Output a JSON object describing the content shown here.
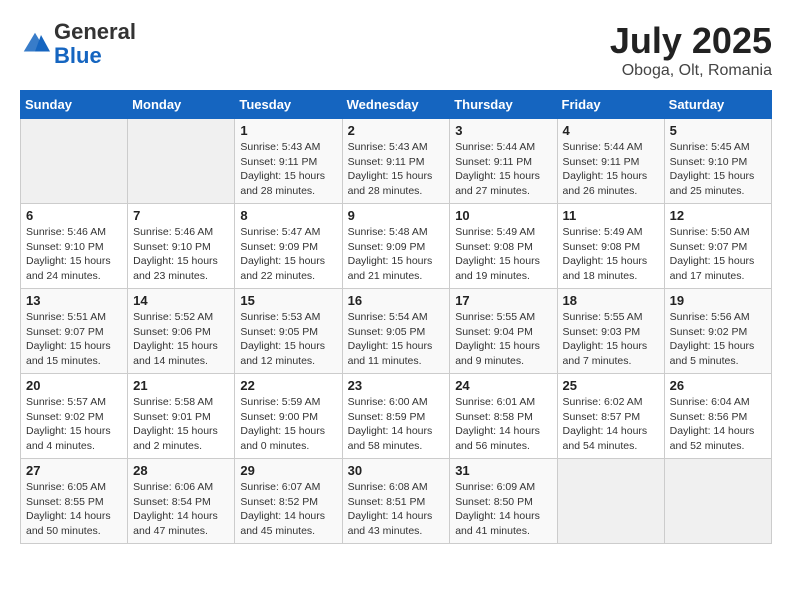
{
  "header": {
    "logo_general": "General",
    "logo_blue": "Blue",
    "month_title": "July 2025",
    "location": "Oboga, Olt, Romania"
  },
  "weekdays": [
    "Sunday",
    "Monday",
    "Tuesday",
    "Wednesday",
    "Thursday",
    "Friday",
    "Saturday"
  ],
  "weeks": [
    [
      {
        "day": "",
        "info": ""
      },
      {
        "day": "",
        "info": ""
      },
      {
        "day": "1",
        "info": "Sunrise: 5:43 AM\nSunset: 9:11 PM\nDaylight: 15 hours\nand 28 minutes."
      },
      {
        "day": "2",
        "info": "Sunrise: 5:43 AM\nSunset: 9:11 PM\nDaylight: 15 hours\nand 28 minutes."
      },
      {
        "day": "3",
        "info": "Sunrise: 5:44 AM\nSunset: 9:11 PM\nDaylight: 15 hours\nand 27 minutes."
      },
      {
        "day": "4",
        "info": "Sunrise: 5:44 AM\nSunset: 9:11 PM\nDaylight: 15 hours\nand 26 minutes."
      },
      {
        "day": "5",
        "info": "Sunrise: 5:45 AM\nSunset: 9:10 PM\nDaylight: 15 hours\nand 25 minutes."
      }
    ],
    [
      {
        "day": "6",
        "info": "Sunrise: 5:46 AM\nSunset: 9:10 PM\nDaylight: 15 hours\nand 24 minutes."
      },
      {
        "day": "7",
        "info": "Sunrise: 5:46 AM\nSunset: 9:10 PM\nDaylight: 15 hours\nand 23 minutes."
      },
      {
        "day": "8",
        "info": "Sunrise: 5:47 AM\nSunset: 9:09 PM\nDaylight: 15 hours\nand 22 minutes."
      },
      {
        "day": "9",
        "info": "Sunrise: 5:48 AM\nSunset: 9:09 PM\nDaylight: 15 hours\nand 21 minutes."
      },
      {
        "day": "10",
        "info": "Sunrise: 5:49 AM\nSunset: 9:08 PM\nDaylight: 15 hours\nand 19 minutes."
      },
      {
        "day": "11",
        "info": "Sunrise: 5:49 AM\nSunset: 9:08 PM\nDaylight: 15 hours\nand 18 minutes."
      },
      {
        "day": "12",
        "info": "Sunrise: 5:50 AM\nSunset: 9:07 PM\nDaylight: 15 hours\nand 17 minutes."
      }
    ],
    [
      {
        "day": "13",
        "info": "Sunrise: 5:51 AM\nSunset: 9:07 PM\nDaylight: 15 hours\nand 15 minutes."
      },
      {
        "day": "14",
        "info": "Sunrise: 5:52 AM\nSunset: 9:06 PM\nDaylight: 15 hours\nand 14 minutes."
      },
      {
        "day": "15",
        "info": "Sunrise: 5:53 AM\nSunset: 9:05 PM\nDaylight: 15 hours\nand 12 minutes."
      },
      {
        "day": "16",
        "info": "Sunrise: 5:54 AM\nSunset: 9:05 PM\nDaylight: 15 hours\nand 11 minutes."
      },
      {
        "day": "17",
        "info": "Sunrise: 5:55 AM\nSunset: 9:04 PM\nDaylight: 15 hours\nand 9 minutes."
      },
      {
        "day": "18",
        "info": "Sunrise: 5:55 AM\nSunset: 9:03 PM\nDaylight: 15 hours\nand 7 minutes."
      },
      {
        "day": "19",
        "info": "Sunrise: 5:56 AM\nSunset: 9:02 PM\nDaylight: 15 hours\nand 5 minutes."
      }
    ],
    [
      {
        "day": "20",
        "info": "Sunrise: 5:57 AM\nSunset: 9:02 PM\nDaylight: 15 hours\nand 4 minutes."
      },
      {
        "day": "21",
        "info": "Sunrise: 5:58 AM\nSunset: 9:01 PM\nDaylight: 15 hours\nand 2 minutes."
      },
      {
        "day": "22",
        "info": "Sunrise: 5:59 AM\nSunset: 9:00 PM\nDaylight: 15 hours\nand 0 minutes."
      },
      {
        "day": "23",
        "info": "Sunrise: 6:00 AM\nSunset: 8:59 PM\nDaylight: 14 hours\nand 58 minutes."
      },
      {
        "day": "24",
        "info": "Sunrise: 6:01 AM\nSunset: 8:58 PM\nDaylight: 14 hours\nand 56 minutes."
      },
      {
        "day": "25",
        "info": "Sunrise: 6:02 AM\nSunset: 8:57 PM\nDaylight: 14 hours\nand 54 minutes."
      },
      {
        "day": "26",
        "info": "Sunrise: 6:04 AM\nSunset: 8:56 PM\nDaylight: 14 hours\nand 52 minutes."
      }
    ],
    [
      {
        "day": "27",
        "info": "Sunrise: 6:05 AM\nSunset: 8:55 PM\nDaylight: 14 hours\nand 50 minutes."
      },
      {
        "day": "28",
        "info": "Sunrise: 6:06 AM\nSunset: 8:54 PM\nDaylight: 14 hours\nand 47 minutes."
      },
      {
        "day": "29",
        "info": "Sunrise: 6:07 AM\nSunset: 8:52 PM\nDaylight: 14 hours\nand 45 minutes."
      },
      {
        "day": "30",
        "info": "Sunrise: 6:08 AM\nSunset: 8:51 PM\nDaylight: 14 hours\nand 43 minutes."
      },
      {
        "day": "31",
        "info": "Sunrise: 6:09 AM\nSunset: 8:50 PM\nDaylight: 14 hours\nand 41 minutes."
      },
      {
        "day": "",
        "info": ""
      },
      {
        "day": "",
        "info": ""
      }
    ]
  ]
}
